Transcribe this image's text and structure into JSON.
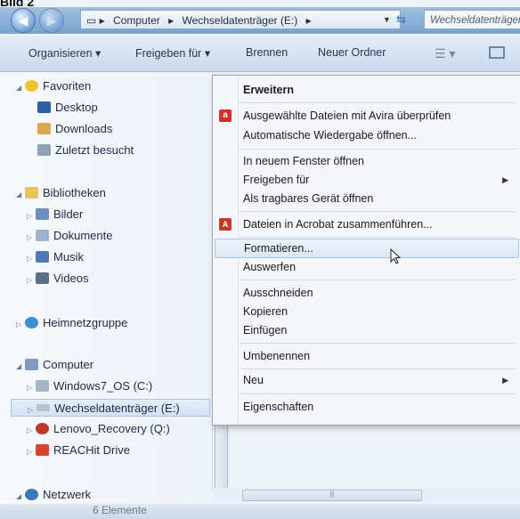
{
  "caption": "Bild 2",
  "address_bar": {
    "crumbs": [
      "Computer",
      "Wechseldatenträger (E:)"
    ],
    "search_placeholder": "Wechseldatenträger"
  },
  "toolbar": {
    "organize": "Organisieren ▾",
    "share": "Freigeben für ▾",
    "burn": "Brennen",
    "new_folder": "Neuer Ordner"
  },
  "nav": {
    "favorites": "Favoriten",
    "desktop": "Desktop",
    "downloads": "Downloads",
    "recent": "Zuletzt besucht",
    "libraries": "Bibliotheken",
    "pictures": "Bilder",
    "documents": "Dokumente",
    "music": "Musik",
    "videos": "Videos",
    "homegroup": "Heimnetzgruppe",
    "computer": "Computer",
    "c_drive": "Windows7_OS (C:)",
    "e_drive": "Wechseldatenträger (E:)",
    "q_drive": "Lenovo_Recovery (Q:)",
    "reachit": "REACHit Drive",
    "network": "Netzwerk"
  },
  "status": "6 Elemente",
  "menu": {
    "expand": "Erweitern",
    "avira": "Ausgewählte Dateien mit Avira überprüfen",
    "autoplay": "Automatische Wiedergabe öffnen...",
    "new_window": "In neuem Fenster öffnen",
    "share_with": "Freigeben für",
    "portable": "Als tragbares Gerät öffnen",
    "acrobat": "Dateien in Acrobat zusammenführen...",
    "format": "Formatieren...",
    "eject": "Auswerfen",
    "cut": "Ausschneiden",
    "copy": "Kopieren",
    "paste": "Einfügen",
    "rename": "Umbenennen",
    "new": "Neu",
    "properties": "Eigenschaften"
  },
  "colors": {
    "avira_red": "#d32f2f",
    "acrobat_red": "#c0392b",
    "folder_yellow": "#e9c45a",
    "hover_blue": "#dbe7f5"
  }
}
